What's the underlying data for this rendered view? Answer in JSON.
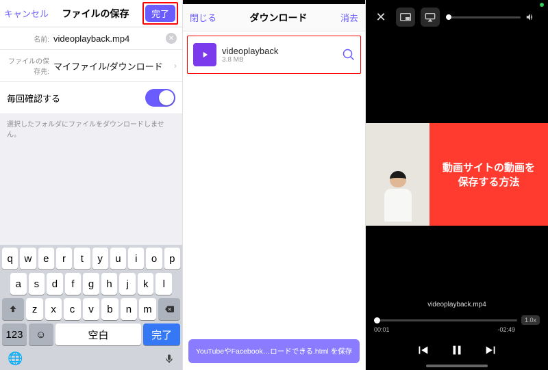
{
  "panel1": {
    "cancel": "キャンセル",
    "title": "ファイルの保存",
    "done": "完了",
    "name_label": "名前:",
    "name_value": "videoplayback.mp4",
    "loc_label": "ファイルの保存先:",
    "loc_value": "マイファイル/ダウンロード",
    "confirm_label": "毎回確認する",
    "note": "選択したフォルダにファイルをダウンロードしません。",
    "keys_r1": [
      "q",
      "w",
      "e",
      "r",
      "t",
      "y",
      "u",
      "i",
      "o",
      "p"
    ],
    "keys_r2": [
      "a",
      "s",
      "d",
      "f",
      "g",
      "h",
      "j",
      "k",
      "l"
    ],
    "keys_r3": [
      "z",
      "x",
      "c",
      "v",
      "b",
      "n",
      "m"
    ],
    "key_123": "123",
    "key_space": "空白",
    "key_done": "完了"
  },
  "panel2": {
    "close": "閉じる",
    "title": "ダウンロード",
    "clear": "消去",
    "file_name": "videoplayback",
    "file_size": "3.8 MB",
    "bottom_bar": "YouTubeやFacebook…ロードできる.html を保存"
  },
  "panel3": {
    "overlay_line1": "動画サイトの動画を",
    "overlay_line2": "保存する方法",
    "file": "videoplayback.mp4",
    "cur_time": "00:01",
    "rem_time": "-02:49",
    "rate": "1.0x"
  }
}
